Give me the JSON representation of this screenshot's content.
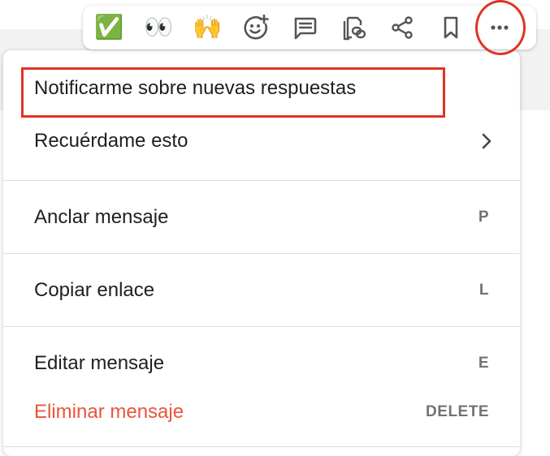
{
  "toolbar": {
    "reactions": [
      {
        "emoji": "✅",
        "name": "check-mark-emoji"
      },
      {
        "emoji": "👀",
        "name": "eyes-emoji"
      },
      {
        "emoji": "🙌",
        "name": "raised-hands-emoji"
      }
    ],
    "icons": [
      "add-reaction-icon",
      "reply-in-thread-icon",
      "copy-link-icon",
      "share-icon",
      "bookmark-icon",
      "more-options-icon"
    ],
    "accent_color": "#e03324"
  },
  "menu": {
    "items": [
      {
        "label": "Notificarme sobre nuevas respuestas",
        "shortcut": ""
      },
      {
        "label": "Recuérdame esto",
        "shortcut": "",
        "has_submenu": true
      },
      {
        "label": "Anclar mensaje",
        "shortcut": "P"
      },
      {
        "label": "Copiar enlace",
        "shortcut": "L"
      },
      {
        "label": "Editar mensaje",
        "shortcut": "E"
      },
      {
        "label": "Eliminar mensaje",
        "shortcut": "DELETE",
        "danger": true
      }
    ],
    "danger_color": "#e8553a"
  }
}
